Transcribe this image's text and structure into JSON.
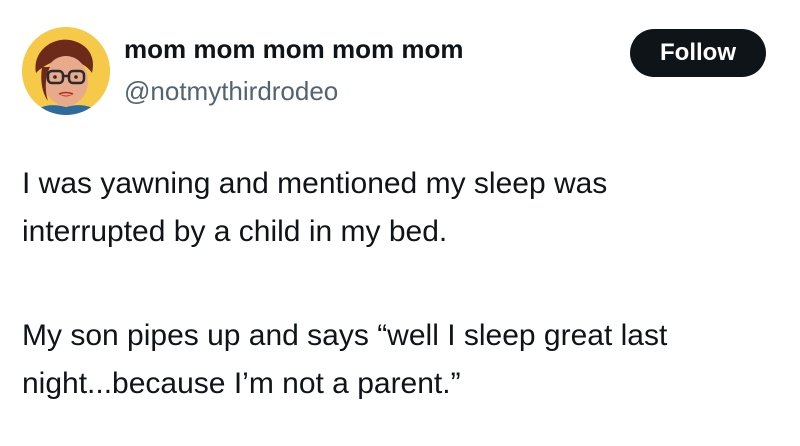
{
  "author": {
    "display_name": "mom mom mom mom mom",
    "handle": "@notmythirdrodeo",
    "avatar_icon": "woman-with-glasses-avatar"
  },
  "actions": {
    "follow_label": "Follow"
  },
  "tweet": {
    "paragraphs": [
      {
        "lines": [
          "I was yawning and mentioned my sleep was",
          "interrupted by a child in my bed."
        ]
      },
      {
        "lines": [
          "My son pipes up and says “well I sleep great last",
          "night...because I’m not a parent.”"
        ]
      }
    ]
  },
  "colors": {
    "text_primary": "#0f1419",
    "text_secondary": "#536471",
    "follow_bg": "#0f1419",
    "follow_text": "#ffffff",
    "avatar_bg": "#f5c54a"
  }
}
